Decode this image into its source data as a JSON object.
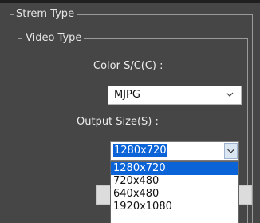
{
  "stream_type_label": "Strem Type",
  "video_type_label": "Video Type",
  "color_space": {
    "label": "Color S/C(C) :",
    "value": "MJPG"
  },
  "output_size": {
    "label": "Output Size(S) :",
    "value": "1280x720",
    "options": [
      "1280x720",
      "720x480",
      "640x480",
      "1920x1080"
    ],
    "highlighted_option": "1280x720"
  },
  "icons": {
    "combo_arrow": "chevron-down-icon"
  },
  "colors": {
    "dialog_bg": "#464646",
    "selection": "#0a64d8",
    "text_light": "#ededed"
  }
}
